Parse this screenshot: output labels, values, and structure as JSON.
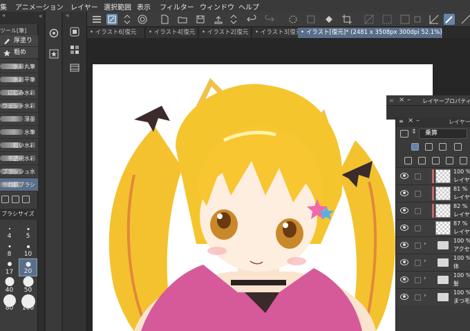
{
  "menu": [
    "集",
    "アニメーション",
    "レイヤー",
    "選択範囲",
    "表示",
    "フィルター",
    "ウィンドウ",
    "ヘルプ"
  ],
  "left_panel": {
    "header": "ツール[筆]",
    "tool_tabs": [
      "厚塗り",
      "粗め"
    ],
    "brushes": [
      "水彩丸筆",
      "水彩平筆",
      "にじみ水彩",
      "ウェット水彩",
      "薄墨",
      "水筆",
      "粗い水彩",
      "不透明水彩",
      "ブラッシュ水彩",
      "やわ肌ブラシ"
    ],
    "selected_brush": "やわ肌ブラシ",
    "size_header": "ブラシサイズ",
    "sizes": [
      "4",
      "5",
      "8",
      "10",
      "17",
      "20",
      "40",
      "50",
      "80",
      "100"
    ],
    "selected_size": "20"
  },
  "tabs": [
    "イラスト6[復元",
    "イラスト4[復元",
    "イラスト2[復元",
    "イラスト3[復元",
    "イラスト[復元]* (2481 x 3508px 300dpi 52.1%)"
  ],
  "property_panel": {
    "title": "レイヤープロパティ"
  },
  "layer_panel": {
    "title": "レイヤー",
    "blend_mode": "乗算",
    "layers": [
      {
        "pct": "100 %",
        "name": "レイヤー",
        "type": "raster"
      },
      {
        "pct": "81 %",
        "name": "レイヤー",
        "type": "raster"
      },
      {
        "pct": "82 %",
        "name": "レイヤー",
        "type": "raster"
      },
      {
        "pct": "87 %",
        "name": "レイヤー",
        "type": "raster"
      },
      {
        "pct": "100 %",
        "name": "アクセ",
        "type": "folder"
      },
      {
        "pct": "100 %",
        "name": "体",
        "type": "folder"
      },
      {
        "pct": "100 %",
        "name": "髪",
        "type": "folder"
      },
      {
        "pct": "100 %",
        "name": "まつ毛",
        "type": "folder"
      }
    ]
  },
  "colors": {
    "accent": "#5a6e8a",
    "hair": "#f2c12e",
    "hair_shadow": "#e08a1e",
    "outfit": "#d65a9a",
    "ears": "#3a2a26"
  }
}
